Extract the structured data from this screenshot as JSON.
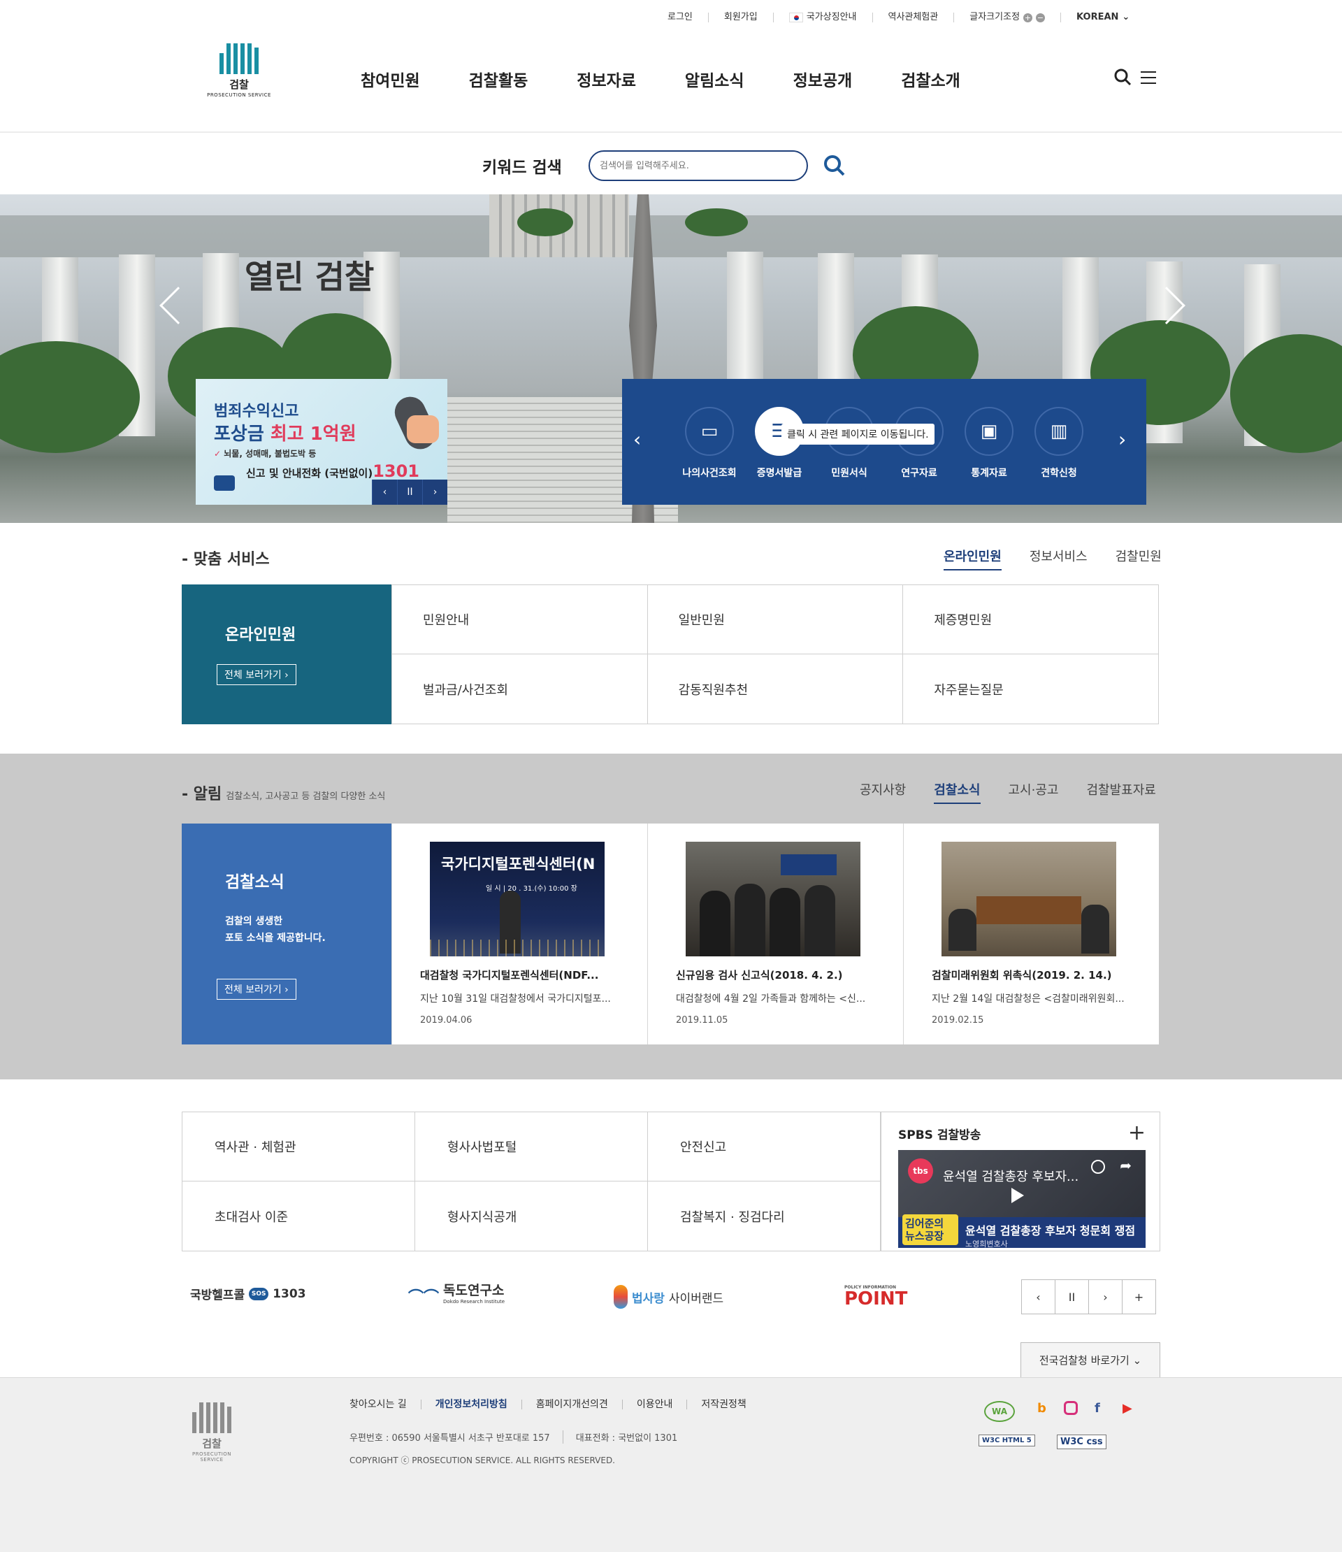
{
  "util": {
    "login": "로그인",
    "join": "회원가입",
    "national_symbol": "국가상징안내",
    "history_hall": "역사관체험관",
    "font_size": "글자크기조정",
    "plus": "+",
    "minus": "−",
    "language": "KOREAN"
  },
  "logo": {
    "ko": "검찰",
    "en": "PROSECUTION SERVICE"
  },
  "gnb": [
    "참여민원",
    "검찰활동",
    "정보자료",
    "알림소식",
    "정보공개",
    "검찰소개"
  ],
  "keyword": {
    "label": "키워드 검색",
    "placeholder": "검색어를 입력해주세요."
  },
  "hero": {
    "title": "열린 검찰"
  },
  "promo": {
    "line1": "범죄수익신고",
    "line2a": "포상금 ",
    "line2b": "최고 1억원",
    "line3": "뇌물, 성매매, 불법도박 등",
    "line4a": "신고 및 안내전화 (국번없이)",
    "line4b": "1301",
    "prev": "‹",
    "pause": "II",
    "next": "›"
  },
  "quick": {
    "items": [
      "나의사건조회",
      "증명서발급",
      "민원서식",
      "연구자료",
      "통계자료",
      "견학신청"
    ],
    "tooltip": "클릭 시 관련 페이지로 이동됩니다."
  },
  "custom": {
    "heading": "- 맞춤 서비스",
    "tabs": [
      "온라인민원",
      "정보서비스",
      "검찰민원"
    ],
    "left_title": "온라인민원",
    "more": "전체 보러가기 ›",
    "cells": [
      "민원안내",
      "일반민원",
      "제증명민원",
      "벌과금/사건조회",
      "감동직원추천",
      "자주묻는질문"
    ]
  },
  "notice": {
    "heading": "- 알림",
    "sub": "검찰소식, 고사공고 등 검찰의 다양한 소식",
    "tabs": [
      "공지사항",
      "검찰소식",
      "고시·공고",
      "검찰발표자료"
    ],
    "left_title": "검찰소식",
    "left_desc": "검찰의 생생한\n포토 소식을 제공합니다.",
    "more": "전체 보러가기 ›",
    "news": [
      {
        "title": "대검찰청 국가디지털포렌식센터(NDF...",
        "desc": "지난 10월 31일 대검찰청에서 국가디지털포...",
        "date": "2019.04.06",
        "img_text": "국가디지털포렌식센터(N",
        "img_sub": "일 시 | 20 . 31.(수) 10:00 장"
      },
      {
        "title": "신규임용 검사 신고식(2018. 4. 2.)",
        "desc": "대검찰청에 4월 2일 가족들과 함께하는 <신...",
        "date": "2019.11.05",
        "img_text": "",
        "img_sub": ""
      },
      {
        "title": "검찰미래위원회 위촉식(2019. 2. 14.)",
        "desc": "지난 2월 14일 대검찰청은 <검찰미래위원회...",
        "date": "2019.02.15",
        "img_text": "",
        "img_sub": ""
      }
    ]
  },
  "links": [
    "역사관 · 체험관",
    "형사사법포털",
    "안전신고",
    "초대검사 이준",
    "형사지식공개",
    "검찰복지 · 징검다리"
  ],
  "video": {
    "title": "SPBS 검찰방송",
    "plus": "+",
    "video_title": "윤석열 검찰총장 후보자...",
    "caption": "윤석열 검찰총장 후보자 청문회 쟁점",
    "caption_sub": "노영희변호사",
    "badge": "tbs",
    "host": "김어준의 뉴스공장"
  },
  "partners": {
    "p1": "국방헬프콜",
    "p1_num": "1303",
    "p2": "독도연구소",
    "p2_en": "Dokdo Research Institute",
    "p3a": "법사랑",
    "p3b": "사이버랜드",
    "p4": "POINT",
    "p4_small": "POLICY INFORMATION",
    "ctrl": [
      "‹",
      "II",
      "›",
      "+"
    ]
  },
  "quicksite": "전국검찰청 바로가기",
  "footer": {
    "links": [
      "찾아오시는 길",
      "개인정보처리방침",
      "홈페이지개선의견",
      "이용안내",
      "저작권정책"
    ],
    "address": "우편번호 : 06590 서울특별시 서초구 반포대로 157",
    "phone": "대표전화 : 국번없이 1301",
    "copyright": "COPYRIGHT ⓒ PROSECUTION SERVICE. ALL RIGHTS RESERVED.",
    "wa": "WA",
    "w3c_html": "W3C HTML 5",
    "w3c_css": "W3C css"
  },
  "colors": {
    "brand": "#1a8fa3",
    "navy": "#1e3f7a",
    "quick_bg": "#1d4a8c",
    "service_bg": "#17657f",
    "news_bg": "#3a6db3"
  }
}
